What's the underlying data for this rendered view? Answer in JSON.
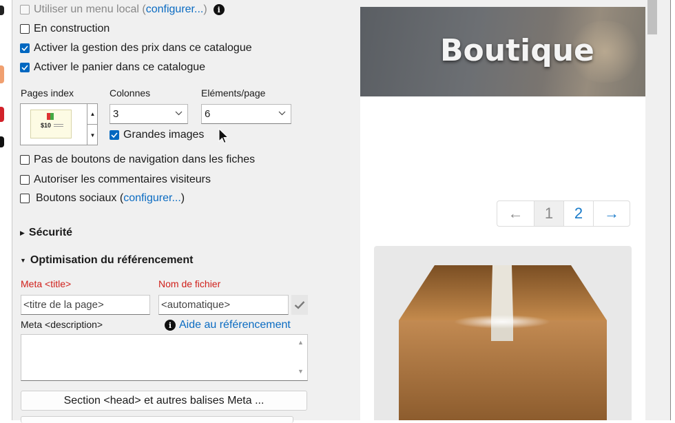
{
  "checkboxes": {
    "local_menu": {
      "label": "Utiliser un menu local (",
      "link": "configurer...",
      "suffix": ")"
    },
    "construction": {
      "label": "En construction"
    },
    "prices": {
      "label": "Activer la gestion des prix dans ce catalogue"
    },
    "cart": {
      "label": "Activer le panier dans ce catalogue"
    },
    "large_images": {
      "label": "Grandes images"
    },
    "no_nav": {
      "label": "Pas de boutons de navigation dans les fiches"
    },
    "comments": {
      "label": "Autoriser les commentaires visiteurs"
    },
    "social": {
      "label": "Boutons sociaux (",
      "link": "configurer...",
      "suffix": ")"
    }
  },
  "catalog": {
    "pages_index_label": "Pages index",
    "columns_label": "Colonnes",
    "columns_value": "3",
    "items_label": "Eléments/page",
    "items_value": "6",
    "thumb_price": "$10"
  },
  "sections": {
    "security": "Sécurité",
    "seo": "Optimisation du référencement"
  },
  "seo": {
    "meta_title_label": "Meta <title>",
    "meta_title_placeholder": "<titre de la page>",
    "filename_label": "Nom de fichier",
    "filename_placeholder": "<automatique>",
    "meta_desc_label": "Meta <description>",
    "help_link": "Aide au référencement",
    "head_button": "Section <head> et autres balises Meta ..."
  },
  "preview": {
    "banner_title": "Boutique",
    "pager": {
      "prev": "←",
      "page1": "1",
      "page2": "2",
      "next": "→"
    }
  },
  "colors": {
    "accent": "#0067c0",
    "link": "#0a6bc2",
    "required_label": "#d0201b"
  }
}
